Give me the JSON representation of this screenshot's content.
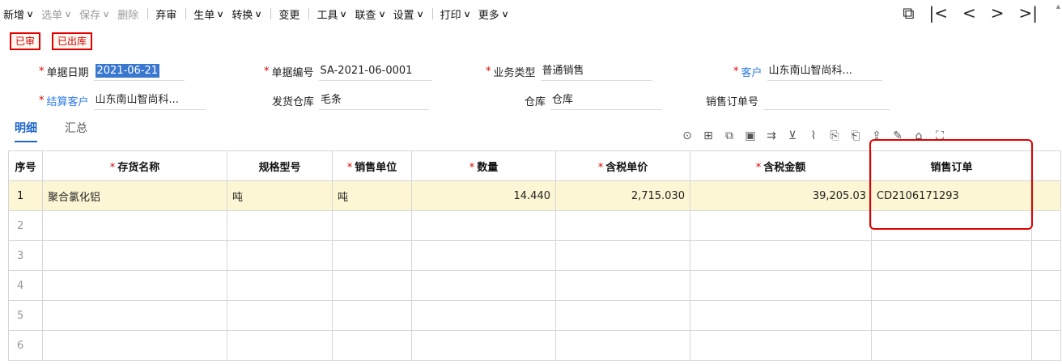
{
  "toolbar": {
    "items": [
      {
        "label": "新增",
        "chevron": true,
        "disabled": false
      },
      {
        "label": "选单",
        "chevron": true,
        "disabled": true
      },
      {
        "label": "保存",
        "chevron": true,
        "disabled": true
      },
      {
        "label": "删除",
        "chevron": false,
        "disabled": true
      },
      {
        "label": "弃审",
        "chevron": false,
        "disabled": false
      },
      {
        "label": "生单",
        "chevron": true,
        "disabled": false
      },
      {
        "label": "转换",
        "chevron": true,
        "disabled": false
      },
      {
        "label": "变更",
        "chevron": false,
        "disabled": false
      },
      {
        "label": "工具",
        "chevron": true,
        "disabled": false
      },
      {
        "label": "联查",
        "chevron": true,
        "disabled": false
      },
      {
        "label": "设置",
        "chevron": true,
        "disabled": false
      },
      {
        "label": "打印",
        "chevron": true,
        "disabled": false
      },
      {
        "label": "更多",
        "chevron": true,
        "disabled": false
      }
    ],
    "chevron_glyph": "∨"
  },
  "nav": {
    "search": "⧉",
    "first": "|<",
    "prev": "<",
    "next": ">",
    "last": ">|"
  },
  "badges": {
    "audited": "已审",
    "outbound": "已出库"
  },
  "form": {
    "date_label": "单据日期",
    "date_value": "2021-06-21",
    "doc_no_label": "单据编号",
    "doc_no_value": "SA-2021-06-0001",
    "biz_type_label": "业务类型",
    "biz_type_value": "普通销售",
    "customer_label": "客户",
    "customer_value": "山东南山智尚科...",
    "settle_label": "结算客户",
    "settle_value": "山东南山智尚科...",
    "ship_wh_label": "发货仓库",
    "ship_wh_value": "毛条",
    "wh_label": "仓库",
    "wh_value": "仓库",
    "so_label": "销售订单号",
    "so_value": ""
  },
  "tabs": {
    "detail": "明细",
    "summary": "汇总"
  },
  "table": {
    "headers": [
      {
        "label": "序号",
        "req": false
      },
      {
        "label": "存货名称",
        "req": true
      },
      {
        "label": "规格型号",
        "req": false
      },
      {
        "label": "销售单位",
        "req": true
      },
      {
        "label": "数量",
        "req": true
      },
      {
        "label": "含税单价",
        "req": true
      },
      {
        "label": "含税金额",
        "req": true
      },
      {
        "label": "销售订单",
        "req": false
      }
    ],
    "rows": [
      {
        "idx": "1",
        "name": "聚合氯化铝",
        "spec": "吨",
        "unit": "吨",
        "qty": "14.440",
        "price": "2,715.030",
        "amount": "39,205.03",
        "order": "CD2106171293"
      },
      {
        "idx": "2",
        "name": "",
        "spec": "",
        "unit": "",
        "qty": "",
        "price": "",
        "amount": "",
        "order": ""
      },
      {
        "idx": "3",
        "name": "",
        "spec": "",
        "unit": "",
        "qty": "",
        "price": "",
        "amount": "",
        "order": ""
      },
      {
        "idx": "4",
        "name": "",
        "spec": "",
        "unit": "",
        "qty": "",
        "price": "",
        "amount": "",
        "order": ""
      },
      {
        "idx": "5",
        "name": "",
        "spec": "",
        "unit": "",
        "qty": "",
        "price": "",
        "amount": "",
        "order": ""
      },
      {
        "idx": "6",
        "name": "",
        "spec": "",
        "unit": "",
        "qty": "",
        "price": "",
        "amount": "",
        "order": ""
      }
    ]
  },
  "accent": "#1b64c8",
  "required_color": "#e00000"
}
